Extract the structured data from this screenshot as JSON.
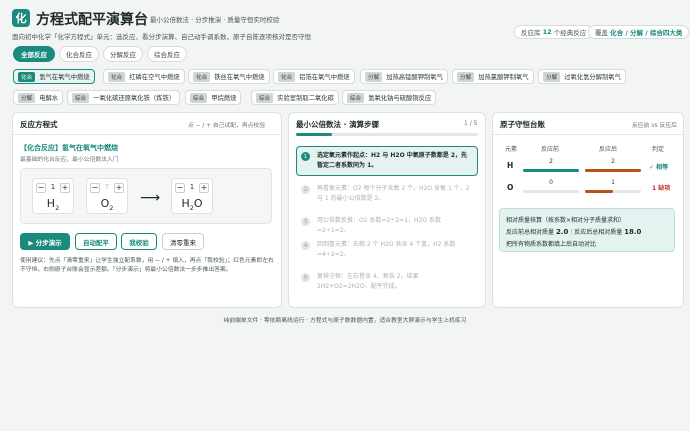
{
  "header": {
    "logo_char": "化",
    "title": "方程式配平演算台",
    "subtitle": "最小公倍数法 · 分步推演 · 质量守恒实时校验",
    "description": "面向初中化学「化学方程式」单元：选反应、看分步演算、自己动手调系数，原子自陈逐项核对是否守恒",
    "pill_library_prefix": "反应库",
    "pill_library_count": "12",
    "pill_library_suffix": "个经典反应",
    "pill_cover_prefix": "覆盖",
    "pill_cover_bold": "化合 / 分解 / 综合四大类"
  },
  "tabs": [
    {
      "label": "全部反应",
      "active": true
    },
    {
      "label": "化合反应",
      "active": false
    },
    {
      "label": "分解反应",
      "active": false
    },
    {
      "label": "综合反应",
      "active": false
    }
  ],
  "reactions": [
    {
      "badge": "化合",
      "label": "氢气在氧气中燃烧",
      "selected": true
    },
    {
      "badge": "化合",
      "label": "红磷在空气中燃烧",
      "selected": false
    },
    {
      "badge": "化合",
      "label": "铁丝在氧气中燃烧",
      "selected": false
    },
    {
      "badge": "化合",
      "label": "铝箔在氧气中燃烧",
      "selected": false
    },
    {
      "badge": "分解",
      "label": "加热高锰酸钾制氧气",
      "selected": false
    },
    {
      "badge": "分解",
      "label": "加热氯酸钾制氧气",
      "selected": false
    },
    {
      "badge": "分解",
      "label": "过氧化氢分解制氧气",
      "selected": false
    },
    {
      "badge": "分解",
      "label": "电解水",
      "selected": false
    },
    {
      "badge": "综合",
      "label": "一氧化碳还原氧化铁（炼铁）",
      "selected": false
    },
    {
      "badge": "综合",
      "label": "甲烷燃烧",
      "selected": false
    },
    {
      "badge": "综合",
      "label": "实验室制取二氧化碳",
      "selected": false
    },
    {
      "badge": "综合",
      "label": "氢氧化钠与硫酸铜反应",
      "selected": false
    }
  ],
  "equation_panel": {
    "title": "反应方程式",
    "note": "点 − / + 自己试配，再点校验",
    "reaction_title": "【化合反应】氢气在氧气中燃烧",
    "reaction_sub": "最基础的化合反应，最小公倍数法入门",
    "species": [
      {
        "coef": "1",
        "formula_main": "H",
        "formula_sub": "2",
        "formula_tail": ""
      },
      {
        "coef": "?",
        "formula_main": "O",
        "formula_sub": "2",
        "formula_tail": ""
      },
      {
        "coef": "1",
        "formula_main": "H",
        "formula_sub": "2",
        "formula_tail": "O"
      }
    ],
    "minus": "−",
    "plus": "+",
    "arrow": "⟶",
    "buttons": {
      "step": "▶ 分步演示",
      "auto": "自动配平",
      "check": "我校验",
      "reset": "清零重来"
    },
    "usage": "使用建议：先点「清零重来」让学生独立配系数，用 − / + 填入，再点「我校验」；红色元素即左右不守恒，右侧原子台账会显示差额。「分步演示」将最小公倍数法一步步推出答案。"
  },
  "steps_panel": {
    "title": "最小公倍数法 · 演算步骤",
    "counter": "1 / 5",
    "progress": 0.2,
    "steps": [
      {
        "num": "1",
        "text": "选定氧元素作起点：H2 与 H2O 中氧原子数都是 2，先暂定二者系数同为 1。",
        "current": true
      },
      {
        "num": "2",
        "text": "再看氧元素：O2 每个分子含氧 2 个，H2O 含氧 1 个，2 与 1 的最小公倍数是 2。",
        "current": false
      },
      {
        "num": "3",
        "text": "用公倍数反推：O2 系数=2÷2=1，H2O 系数=2÷1=2。",
        "current": false
      },
      {
        "num": "4",
        "text": "回到氢元素：右侧 2 个 H2O 共含 4 个氢，H2 系数=4÷2=2。",
        "current": false
      },
      {
        "num": "5",
        "text": "复核守恒：左右皆含 4、氧各 2，结果 2H2+O2=2H2O，配平完成。",
        "current": false
      }
    ]
  },
  "ledger_panel": {
    "title": "原子守恒台账",
    "note": "反应前 vs 反应后",
    "col_element": "元素",
    "col_before": "反应前",
    "col_after": "反应后",
    "col_judge": "判定",
    "rows": [
      {
        "element": "H",
        "before": "2",
        "after": "2",
        "before_frac": 1.0,
        "after_frac": 1.0,
        "judge": "✓ 相等",
        "ok": true
      },
      {
        "element": "O",
        "before": "0",
        "after": "1",
        "before_frac": 0.0,
        "after_frac": 0.5,
        "judge": "1 缺项",
        "ok": false
      }
    ],
    "summary_line1": "相对质量核算（按系数×相对分子质量求和）",
    "summary_before_label": "反应前总相对质量",
    "summary_before_value": "2.0",
    "summary_sep": "|",
    "summary_after_label": "反应后总相对质量",
    "summary_after_value": "18.0",
    "summary_line3": "把所有物质系数都填上后自动对比"
  },
  "footer": "纯前端单文件 · 零依赖离线运行 · 方程式与原子数数据内置，适合教室大屏演示与学生上机练习",
  "colors": {
    "accent": "#1a8a7c",
    "warn": "#b5531a",
    "bad": "#c0392b"
  }
}
